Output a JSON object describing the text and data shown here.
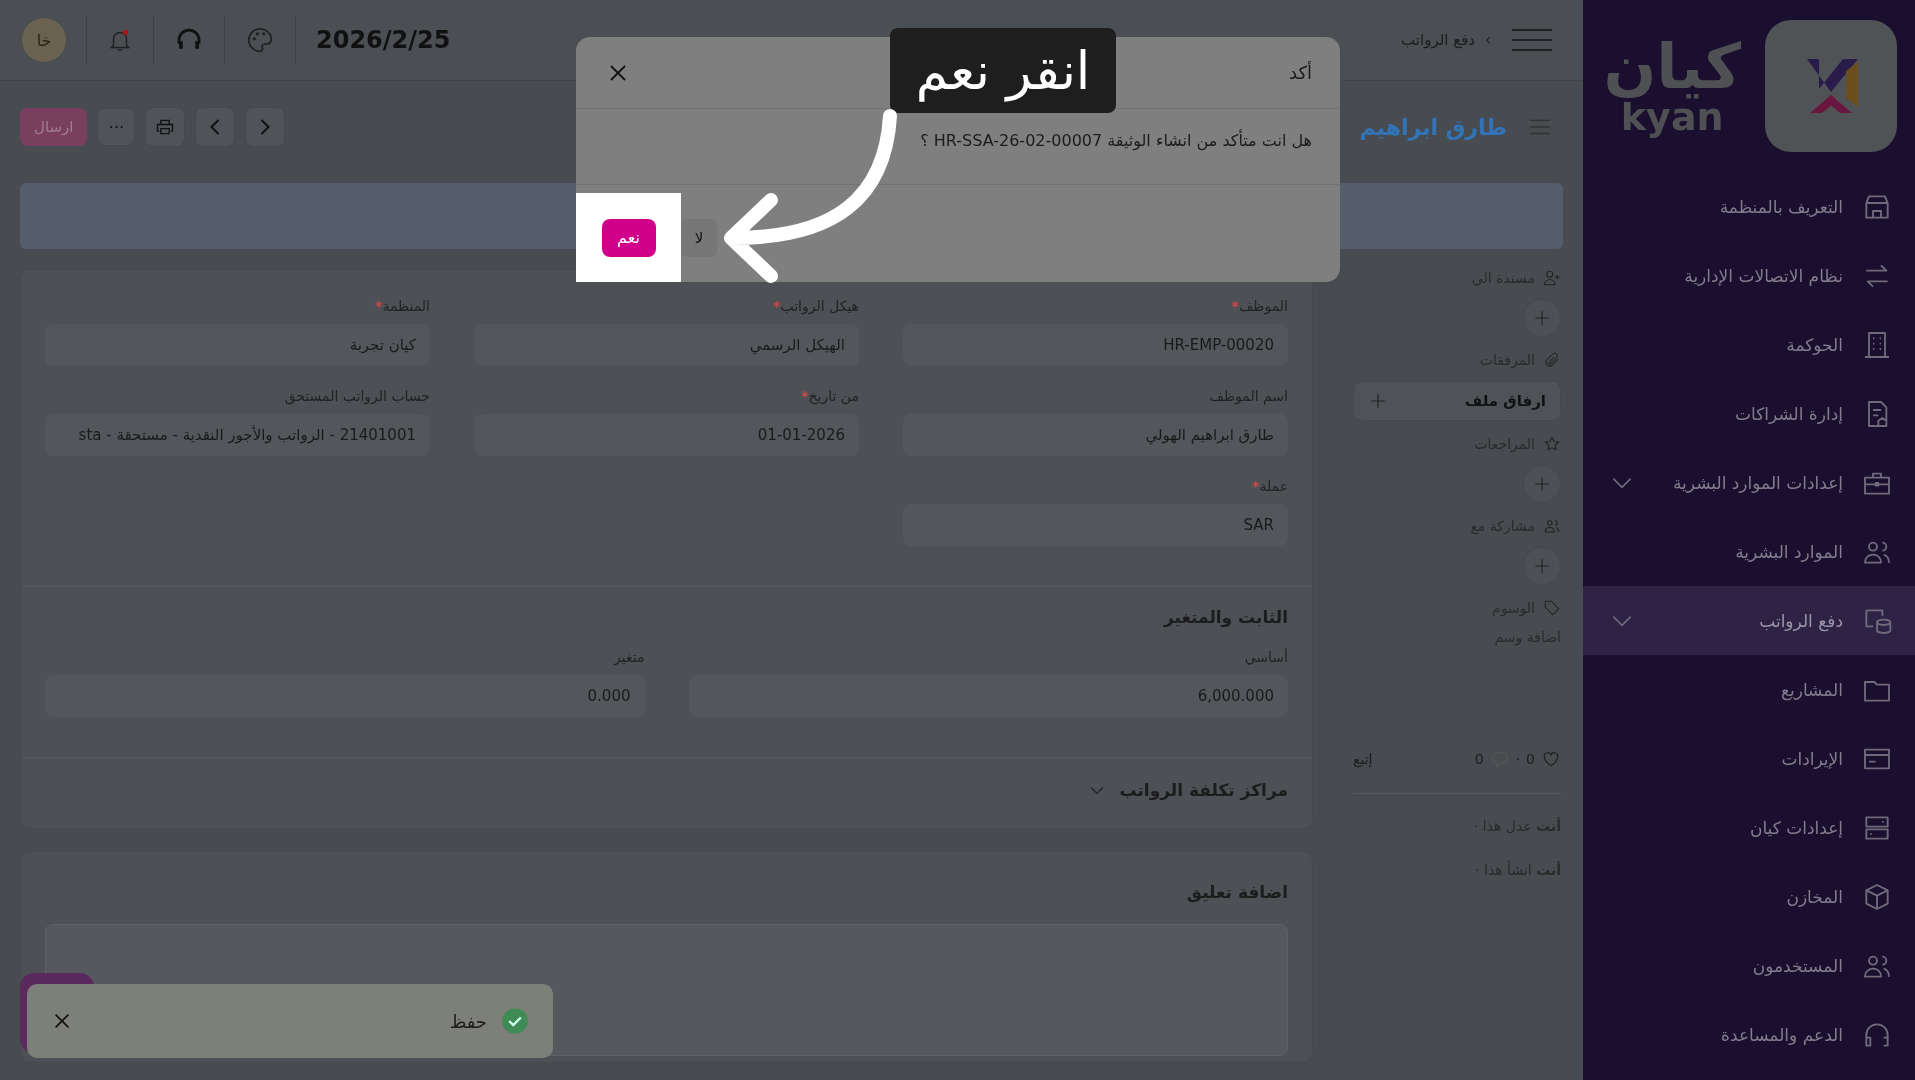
{
  "sidebar": {
    "logo": {
      "arabic": "كيان",
      "latin": "kyan"
    },
    "items": [
      {
        "label": "التعريف بالمنظمة",
        "expandable": false,
        "selected": false
      },
      {
        "label": "نظام الاتصالات الإدارية",
        "expandable": false,
        "selected": false
      },
      {
        "label": "الحوكمة",
        "expandable": false,
        "selected": false
      },
      {
        "label": "إدارة الشراكات",
        "expandable": false,
        "selected": false
      },
      {
        "label": "إعدادات الموارد البشرية",
        "expandable": true,
        "selected": false
      },
      {
        "label": "الموارد البشرية",
        "expandable": false,
        "selected": false
      },
      {
        "label": "دفع الرواتب",
        "expandable": true,
        "selected": true
      },
      {
        "label": "المشاريع",
        "expandable": false,
        "selected": false
      },
      {
        "label": "الإيرادات",
        "expandable": false,
        "selected": false
      },
      {
        "label": "إعدادات كيان",
        "expandable": false,
        "selected": false
      },
      {
        "label": "المخازن",
        "expandable": false,
        "selected": false
      },
      {
        "label": "المستخدمون",
        "expandable": false,
        "selected": false
      },
      {
        "label": "الدعم والمساعدة",
        "expandable": false,
        "selected": false
      }
    ]
  },
  "header": {
    "breadcrumb": [
      "دفع الرواتب"
    ],
    "breadcrumb_separator": "›",
    "date": "2026/2/25",
    "avatar": "خا",
    "notification": true
  },
  "toolbar": {
    "title": "طارق ابراهيم",
    "submit": "ارسال",
    "more": "···"
  },
  "side_panel": {
    "sections": [
      {
        "kind": "add",
        "label": "مسندة الي"
      },
      {
        "kind": "attach",
        "label": "المرفقات",
        "button": "ارفاق ملف"
      },
      {
        "kind": "add",
        "label": "المراجعات"
      },
      {
        "kind": "add",
        "label": "مشاركة مع"
      },
      {
        "kind": "tags",
        "label": "الوسوم",
        "link": "اضافة وسم"
      }
    ],
    "likes": "0",
    "separator": "·",
    "comments": "0",
    "follow": "إتبع",
    "activity": [
      "**أنت** عدل هذا ·",
      "**أنت** انشأ هذا ·"
    ]
  },
  "form": {
    "required_mark": "*",
    "fields": [
      {
        "label": "الموظف",
        "required": true,
        "value": "HR-EMP-00020"
      },
      {
        "label": "هيكل الرواتب",
        "required": true,
        "value": "الهيكل الرسمي"
      },
      {
        "label": "المنظمة",
        "required": true,
        "value": "كيان تجربة"
      },
      {
        "label": "اسم الموظف",
        "required": false,
        "value": "طارق ابراهيم الهولي"
      },
      {
        "label": "من تاريخ",
        "required": true,
        "value": "01-01-2026"
      },
      {
        "label": "حساب الرواتب المستحق",
        "required": false,
        "value": "21401001 - الرواتب والأجور النقدية - مستحقة - sta"
      },
      {
        "label": "عملة",
        "required": true,
        "value": "SAR"
      }
    ],
    "section_title": "الثابت والمتغير",
    "amounts": [
      {
        "label": "أساسي",
        "value": "6,000.000"
      },
      {
        "label": "متغير",
        "value": "0.000"
      }
    ],
    "collapsible": {
      "label": "مراكز تكلفة الرواتب",
      "expanded": false
    }
  },
  "comment": {
    "title": "اضافة تعليق"
  },
  "dialog": {
    "title": "أكد",
    "message": "هل انت متأكد من انشاء الوثيقة HR-SSA-26-02-00007 ؟",
    "confirm": "نعم",
    "cancel": "لا"
  },
  "callout": {
    "text": "انقر نعم"
  },
  "toast": {
    "text": "حفظ"
  }
}
